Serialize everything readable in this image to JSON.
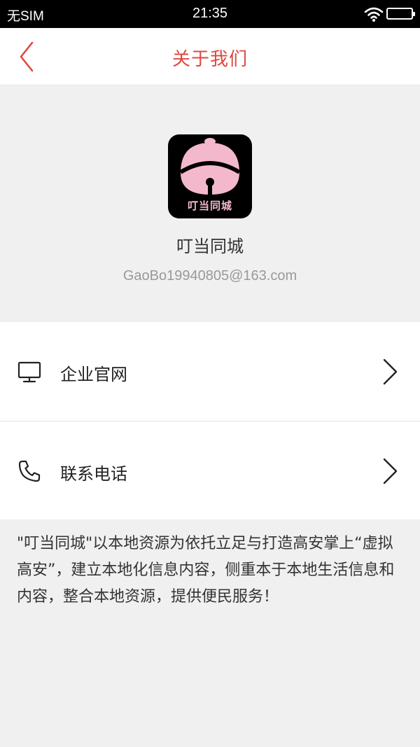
{
  "status_bar": {
    "carrier": "无SIM",
    "time": "21:35"
  },
  "nav": {
    "title": "关于我们"
  },
  "app": {
    "logo_text": "叮当同城",
    "name": "叮当同城",
    "email": "GaoBo19940805@163.com"
  },
  "menu": {
    "items": [
      {
        "label": "企业官网",
        "icon": "monitor-icon"
      },
      {
        "label": "联系电话",
        "icon": "phone-icon"
      }
    ]
  },
  "about": {
    "text": "\"叮当同城\"以本地资源为依托立足与打造高安掌上“虚拟高安”，建立本地化信息内容，侧重本于本地生活信息和内容，整合本地资源，提供便民服务！"
  },
  "colors": {
    "accent": "#e0473f",
    "background": "#f0f0f0",
    "logo_pink": "#f3b8cc"
  }
}
